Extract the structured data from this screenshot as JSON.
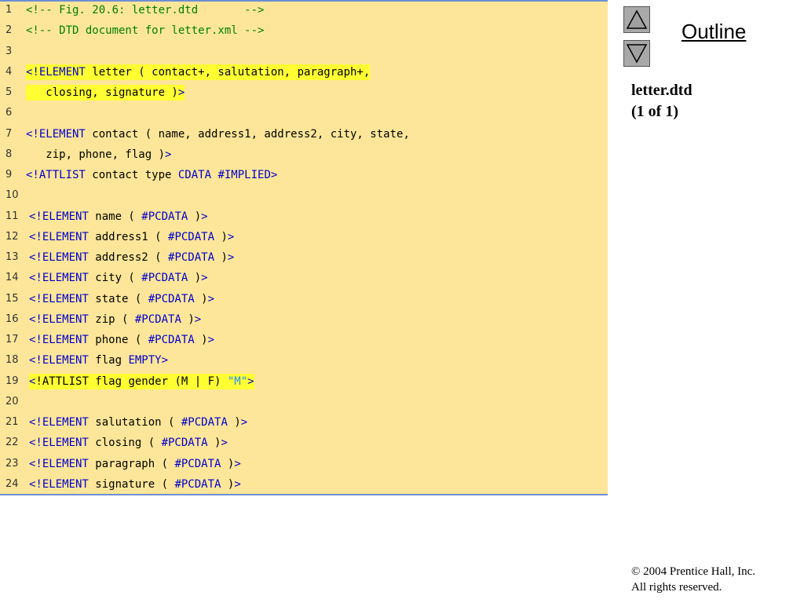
{
  "nav": {
    "up_icon": "triangle-up-icon",
    "down_icon": "triangle-down-icon",
    "outline_label": "Outline"
  },
  "slide_info": {
    "filename": "letter.dtd",
    "pages": "(1 of 1)"
  },
  "copyright": {
    "symbol": "©",
    "line1": " 2004 Prentice Hall, Inc.",
    "line2": "All rights reserved."
  },
  "colors": {
    "panel_bg": "#fde699",
    "highlight": "#ffff33",
    "comment": "#008000",
    "keyword": "#0000cc",
    "string": "#1e90ff"
  },
  "code_lines": [
    {
      "n": "1",
      "indent": false,
      "hl": false,
      "tokens": [
        [
          "c",
          "<!-- Fig. 20.6: letter.dtd       -->"
        ]
      ]
    },
    {
      "n": "2",
      "indent": false,
      "hl": false,
      "tokens": [
        [
          "c",
          "<!-- DTD document for letter.xml -->"
        ]
      ]
    },
    {
      "n": "3",
      "indent": false,
      "hl": false,
      "tokens": []
    },
    {
      "n": "4",
      "indent": false,
      "hl": true,
      "tokens": [
        [
          "k",
          "<!ELEMENT"
        ],
        [
          "t",
          " letter ( contact+, salutation, paragraph+,"
        ]
      ]
    },
    {
      "n": "5",
      "indent": false,
      "hl": true,
      "tokens": [
        [
          "t",
          "   closing, signature )"
        ],
        [
          "k",
          ">"
        ]
      ]
    },
    {
      "n": "6",
      "indent": false,
      "hl": false,
      "tokens": []
    },
    {
      "n": "7",
      "indent": false,
      "hl": false,
      "tokens": [
        [
          "k",
          "<!ELEMENT"
        ],
        [
          "t",
          " contact ( name, address1, address2, city, state,"
        ]
      ]
    },
    {
      "n": "8",
      "indent": false,
      "hl": false,
      "tokens": [
        [
          "t",
          "   zip, phone, flag )"
        ],
        [
          "k",
          ">"
        ]
      ]
    },
    {
      "n": "9",
      "indent": false,
      "hl": false,
      "tokens": [
        [
          "k",
          "<!ATTLIST"
        ],
        [
          "t",
          " contact type "
        ],
        [
          "k",
          "CDATA #IMPLIED>"
        ]
      ]
    },
    {
      "n": "10",
      "indent": false,
      "hl": false,
      "tokens": []
    },
    {
      "n": "11",
      "indent": true,
      "hl": false,
      "tokens": [
        [
          "k",
          "<!ELEMENT"
        ],
        [
          "t",
          " name ( "
        ],
        [
          "k",
          "#PCDATA"
        ],
        [
          "t",
          " )"
        ],
        [
          "k",
          ">"
        ]
      ]
    },
    {
      "n": "12",
      "indent": true,
      "hl": false,
      "tokens": [
        [
          "k",
          "<!ELEMENT"
        ],
        [
          "t",
          " address1 ( "
        ],
        [
          "k",
          "#PCDATA"
        ],
        [
          "t",
          " )"
        ],
        [
          "k",
          ">"
        ]
      ]
    },
    {
      "n": "13",
      "indent": true,
      "hl": false,
      "tokens": [
        [
          "k",
          "<!ELEMENT"
        ],
        [
          "t",
          " address2 ( "
        ],
        [
          "k",
          "#PCDATA"
        ],
        [
          "t",
          " )"
        ],
        [
          "k",
          ">"
        ]
      ]
    },
    {
      "n": "14",
      "indent": true,
      "hl": false,
      "tokens": [
        [
          "k",
          "<!ELEMENT"
        ],
        [
          "t",
          " city ( "
        ],
        [
          "k",
          "#PCDATA"
        ],
        [
          "t",
          " )"
        ],
        [
          "k",
          ">"
        ]
      ]
    },
    {
      "n": "15",
      "indent": true,
      "hl": false,
      "tokens": [
        [
          "k",
          "<!ELEMENT"
        ],
        [
          "t",
          " state ( "
        ],
        [
          "k",
          "#PCDATA"
        ],
        [
          "t",
          " )"
        ],
        [
          "k",
          ">"
        ]
      ]
    },
    {
      "n": "16",
      "indent": true,
      "hl": false,
      "tokens": [
        [
          "k",
          "<!ELEMENT"
        ],
        [
          "t",
          " zip ( "
        ],
        [
          "k",
          "#PCDATA"
        ],
        [
          "t",
          " )"
        ],
        [
          "k",
          ">"
        ]
      ]
    },
    {
      "n": "17",
      "indent": true,
      "hl": false,
      "tokens": [
        [
          "k",
          "<!ELEMENT"
        ],
        [
          "t",
          " phone ( "
        ],
        [
          "k",
          "#PCDATA"
        ],
        [
          "t",
          " )"
        ],
        [
          "k",
          ">"
        ]
      ]
    },
    {
      "n": "18",
      "indent": true,
      "hl": false,
      "tokens": [
        [
          "k",
          "<!ELEMENT"
        ],
        [
          "t",
          " flag "
        ],
        [
          "k",
          "EMPTY>"
        ]
      ]
    },
    {
      "n": "19",
      "indent": true,
      "hl": true,
      "tokens": [
        [
          "k",
          "<"
        ],
        [
          "t",
          "!ATTLIST flag gender (M | F) "
        ],
        [
          "s",
          "\"M\""
        ],
        [
          "k",
          ">"
        ]
      ]
    },
    {
      "n": "20",
      "indent": false,
      "hl": false,
      "tokens": []
    },
    {
      "n": "21",
      "indent": true,
      "hl": false,
      "tokens": [
        [
          "k",
          "<!ELEMENT"
        ],
        [
          "t",
          " salutation ( "
        ],
        [
          "k",
          "#PCDATA"
        ],
        [
          "t",
          " )"
        ],
        [
          "k",
          ">"
        ]
      ]
    },
    {
      "n": "22",
      "indent": true,
      "hl": false,
      "tokens": [
        [
          "k",
          "<!ELEMENT"
        ],
        [
          "t",
          " closing ( "
        ],
        [
          "k",
          "#PCDATA"
        ],
        [
          "t",
          " )"
        ],
        [
          "k",
          ">"
        ]
      ]
    },
    {
      "n": "23",
      "indent": true,
      "hl": false,
      "tokens": [
        [
          "k",
          "<!ELEMENT"
        ],
        [
          "t",
          " paragraph ( "
        ],
        [
          "k",
          "#PCDATA"
        ],
        [
          "t",
          " )"
        ],
        [
          "k",
          ">"
        ]
      ]
    },
    {
      "n": "24",
      "indent": true,
      "hl": false,
      "tokens": [
        [
          "k",
          "<!ELEMENT"
        ],
        [
          "t",
          " signature ( "
        ],
        [
          "k",
          "#PCDATA"
        ],
        [
          "t",
          " )"
        ],
        [
          "k",
          ">"
        ]
      ]
    }
  ]
}
